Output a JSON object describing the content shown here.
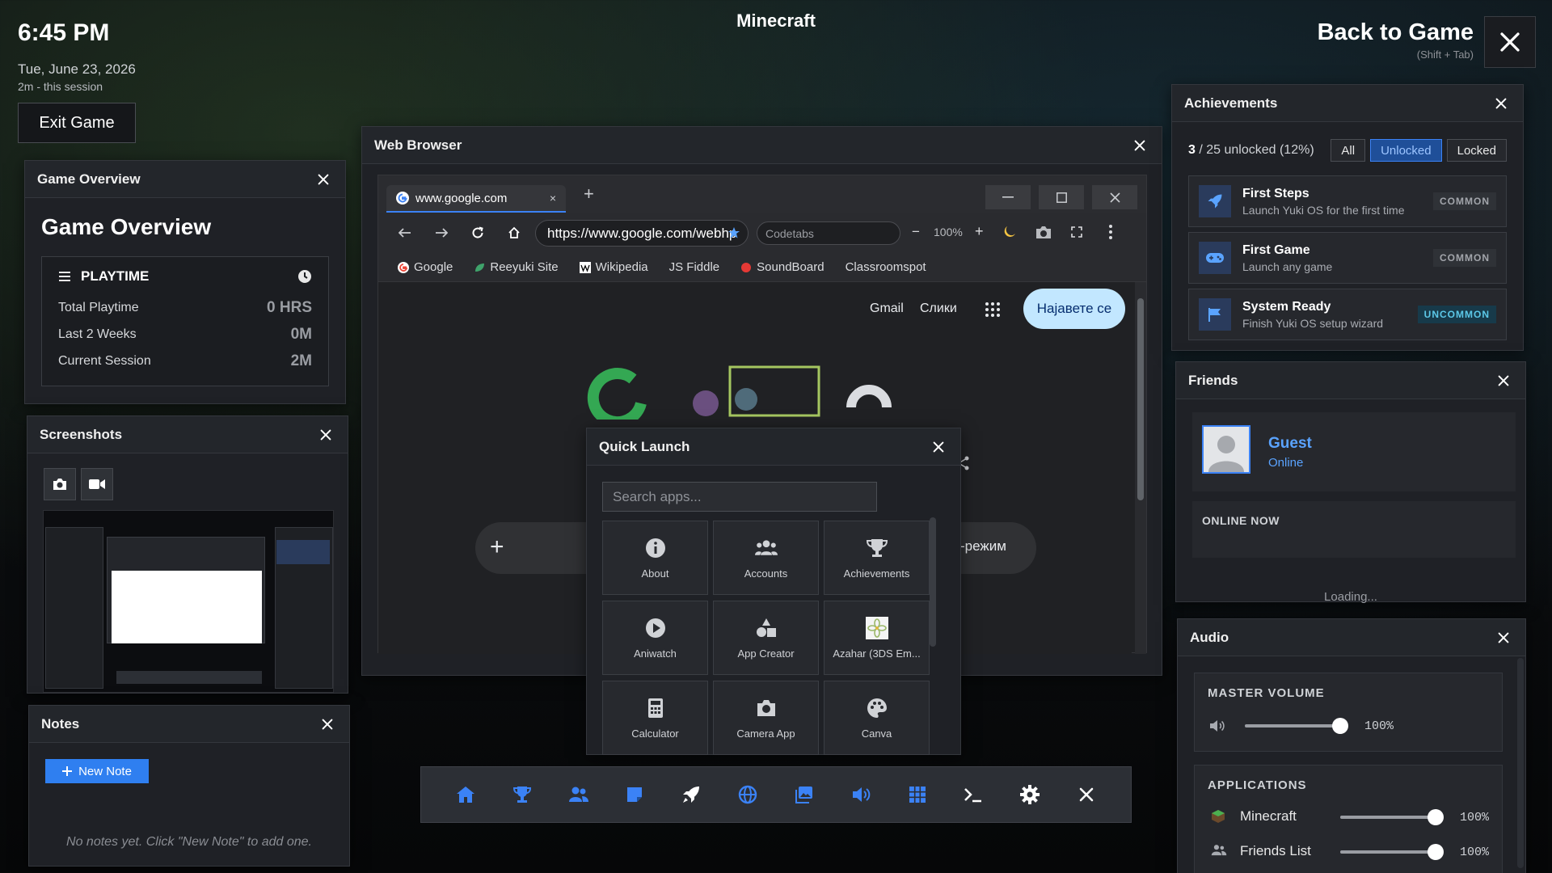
{
  "top": {
    "clock": "6:45 PM",
    "date": "Tue, June 23, 2026",
    "session": "2m - this session",
    "exit_label": "Exit Game",
    "game_title": "Minecraft",
    "back_label": "Back to Game",
    "back_hint": "(Shift + Tab)"
  },
  "overview": {
    "panel_title": "Game Overview",
    "heading": "Game Overview",
    "playtime_label": "PLAYTIME",
    "stats": [
      {
        "label": "Total Playtime",
        "value": "0 HRS"
      },
      {
        "label": "Last 2 Weeks",
        "value": "0M"
      },
      {
        "label": "Current Session",
        "value": "2M"
      }
    ]
  },
  "screenshots": {
    "panel_title": "Screenshots"
  },
  "notes": {
    "panel_title": "Notes",
    "new_note_label": "New Note",
    "empty_text": "No notes yet. Click \"New Note\" to add one."
  },
  "browser": {
    "panel_title": "Web Browser",
    "tab_title": "www.google.com",
    "tab_close": "×",
    "new_tab": "+",
    "url": "https://www.google.com/webhp",
    "proxy_placeholder": "Codetabs",
    "zoom": "100%",
    "zoom_minus": "−",
    "zoom_plus": "+",
    "bookmarks": [
      "Google",
      "Reeyuki Site",
      "Wikipedia",
      "JS Fiddle",
      "SoundBoard",
      "Classroomspot"
    ],
    "google": {
      "gmail": "Gmail",
      "images": "Слики",
      "signin": "Најавете се",
      "plus": "+",
      "mode_fragment": "-режим"
    }
  },
  "quick_launch": {
    "panel_title": "Quick Launch",
    "search_placeholder": "Search apps...",
    "apps": [
      {
        "label": "About",
        "icon": "info-icon"
      },
      {
        "label": "Accounts",
        "icon": "users-icon"
      },
      {
        "label": "Achievements",
        "icon": "trophy-icon"
      },
      {
        "label": "Aniwatch",
        "icon": "play-icon"
      },
      {
        "label": "App Creator",
        "icon": "shapes-icon"
      },
      {
        "label": "Azahar (3DS Em...",
        "icon": "azahar-logo-icon"
      },
      {
        "label": "Calculator",
        "icon": "calculator-icon"
      },
      {
        "label": "Camera App",
        "icon": "camera-icon"
      },
      {
        "label": "Canva",
        "icon": "palette-icon"
      }
    ]
  },
  "taskbar": {
    "icons": [
      "home-icon",
      "trophy-icon",
      "friends-icon",
      "notes-icon",
      "rocket-icon",
      "globe-icon",
      "images-icon",
      "volume-icon",
      "grid-icon",
      "terminal-icon",
      "settings-icon",
      "close-icon"
    ]
  },
  "achievements": {
    "panel_title": "Achievements",
    "count_num": "3",
    "count_rest": " / 25 unlocked (12%)",
    "filters": [
      "All",
      "Unlocked",
      "Locked"
    ],
    "active_filter": "Unlocked",
    "items": [
      {
        "name": "First Steps",
        "desc": "Launch Yuki OS for the first time",
        "rarity": "COMMON",
        "icon": "rocket-icon"
      },
      {
        "name": "First Game",
        "desc": "Launch any game",
        "rarity": "COMMON",
        "icon": "gamepad-icon"
      },
      {
        "name": "System Ready",
        "desc": "Finish Yuki OS setup wizard",
        "rarity": "UNCOMMON",
        "icon": "flag-icon"
      }
    ]
  },
  "friends": {
    "panel_title": "Friends",
    "name": "Guest",
    "status": "Online",
    "online_now": "ONLINE NOW",
    "loading": "Loading..."
  },
  "audio": {
    "panel_title": "Audio",
    "master_label": "MASTER VOLUME",
    "master_value": "100%",
    "master_level": 1.0,
    "apps_label": "APPLICATIONS",
    "apps": [
      {
        "name": "Minecraft",
        "value": "100%",
        "level": 1.0
      },
      {
        "name": "Friends List",
        "value": "100%",
        "level": 1.0
      }
    ]
  },
  "colors": {
    "accent": "#3b82f6",
    "panel": "#1f2126",
    "uncommon": "#5cc8e8"
  }
}
